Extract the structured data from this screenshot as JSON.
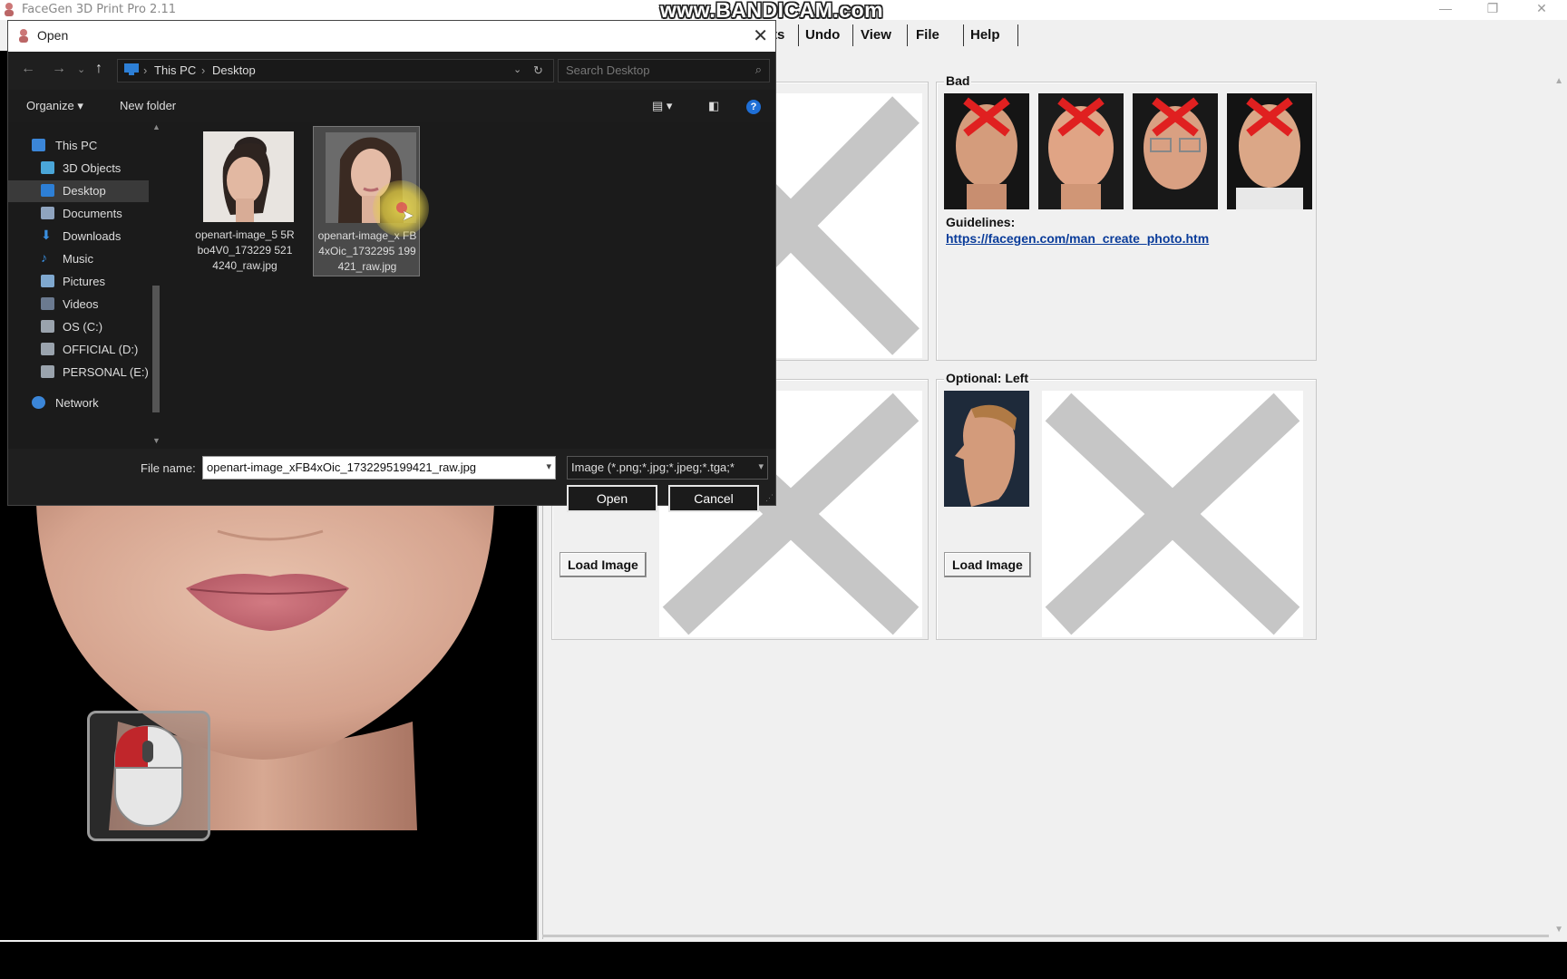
{
  "app": {
    "title": "FaceGen 3D Print Pro 2.11",
    "watermark": "www.BANDICAM.com"
  },
  "menu": {
    "items": [
      "ts",
      "Undo",
      "View",
      "File",
      "Help"
    ]
  },
  "panels": {
    "bad": {
      "label": "Bad",
      "guidelines_label": "Guidelines:",
      "guidelines_link": "https://facegen.com/man_create_photo.htm"
    },
    "optional_left": {
      "label": "Optional: Left",
      "load_button": "Load Image"
    },
    "front_load_button": "Load Image"
  },
  "dialog": {
    "title": "Open",
    "breadcrumb": [
      "This PC",
      "Desktop"
    ],
    "search_placeholder": "Search Desktop",
    "toolbar": {
      "organize": "Organize ▾",
      "new_folder": "New folder"
    },
    "nav_items": [
      {
        "label": "This PC",
        "icon": "computer-icon"
      },
      {
        "label": "3D Objects",
        "icon": "cube-icon"
      },
      {
        "label": "Desktop",
        "icon": "desktop-icon",
        "selected": true
      },
      {
        "label": "Documents",
        "icon": "document-icon"
      },
      {
        "label": "Downloads",
        "icon": "download-icon"
      },
      {
        "label": "Music",
        "icon": "music-icon"
      },
      {
        "label": "Pictures",
        "icon": "pictures-icon"
      },
      {
        "label": "Videos",
        "icon": "video-icon"
      },
      {
        "label": "OS (C:)",
        "icon": "drive-icon"
      },
      {
        "label": "OFFICIAL (D:)",
        "icon": "drive-icon"
      },
      {
        "label": "PERSONAL (E:)",
        "icon": "drive-icon"
      },
      {
        "label": "Network",
        "icon": "network-icon"
      }
    ],
    "files": [
      {
        "name": "openart-image_55Rbo4V0_1732295214240_raw.jpg",
        "display": "openart-image_5 5Rbo4V0_173229 5214240_raw.jpg"
      },
      {
        "name": "openart-image_xFB4xOic_1732295199421_raw.jpg",
        "display": "openart-image_x FB4xOic_1732295 199421_raw.jpg",
        "selected": true
      }
    ],
    "file_name_label": "File name:",
    "file_name_value": "openart-image_xFB4xOic_1732295199421_raw.jpg",
    "file_type_value": "Image (*.png;*.jpg;*.jpeg;*.tga;*",
    "open_button": "Open",
    "cancel_button": "Cancel"
  },
  "colors": {
    "link": "#0a3c9a",
    "x_mark": "#c6c6c6",
    "dialog_bg": "#1f1f1f",
    "help_icon": "#1f6fd6"
  }
}
